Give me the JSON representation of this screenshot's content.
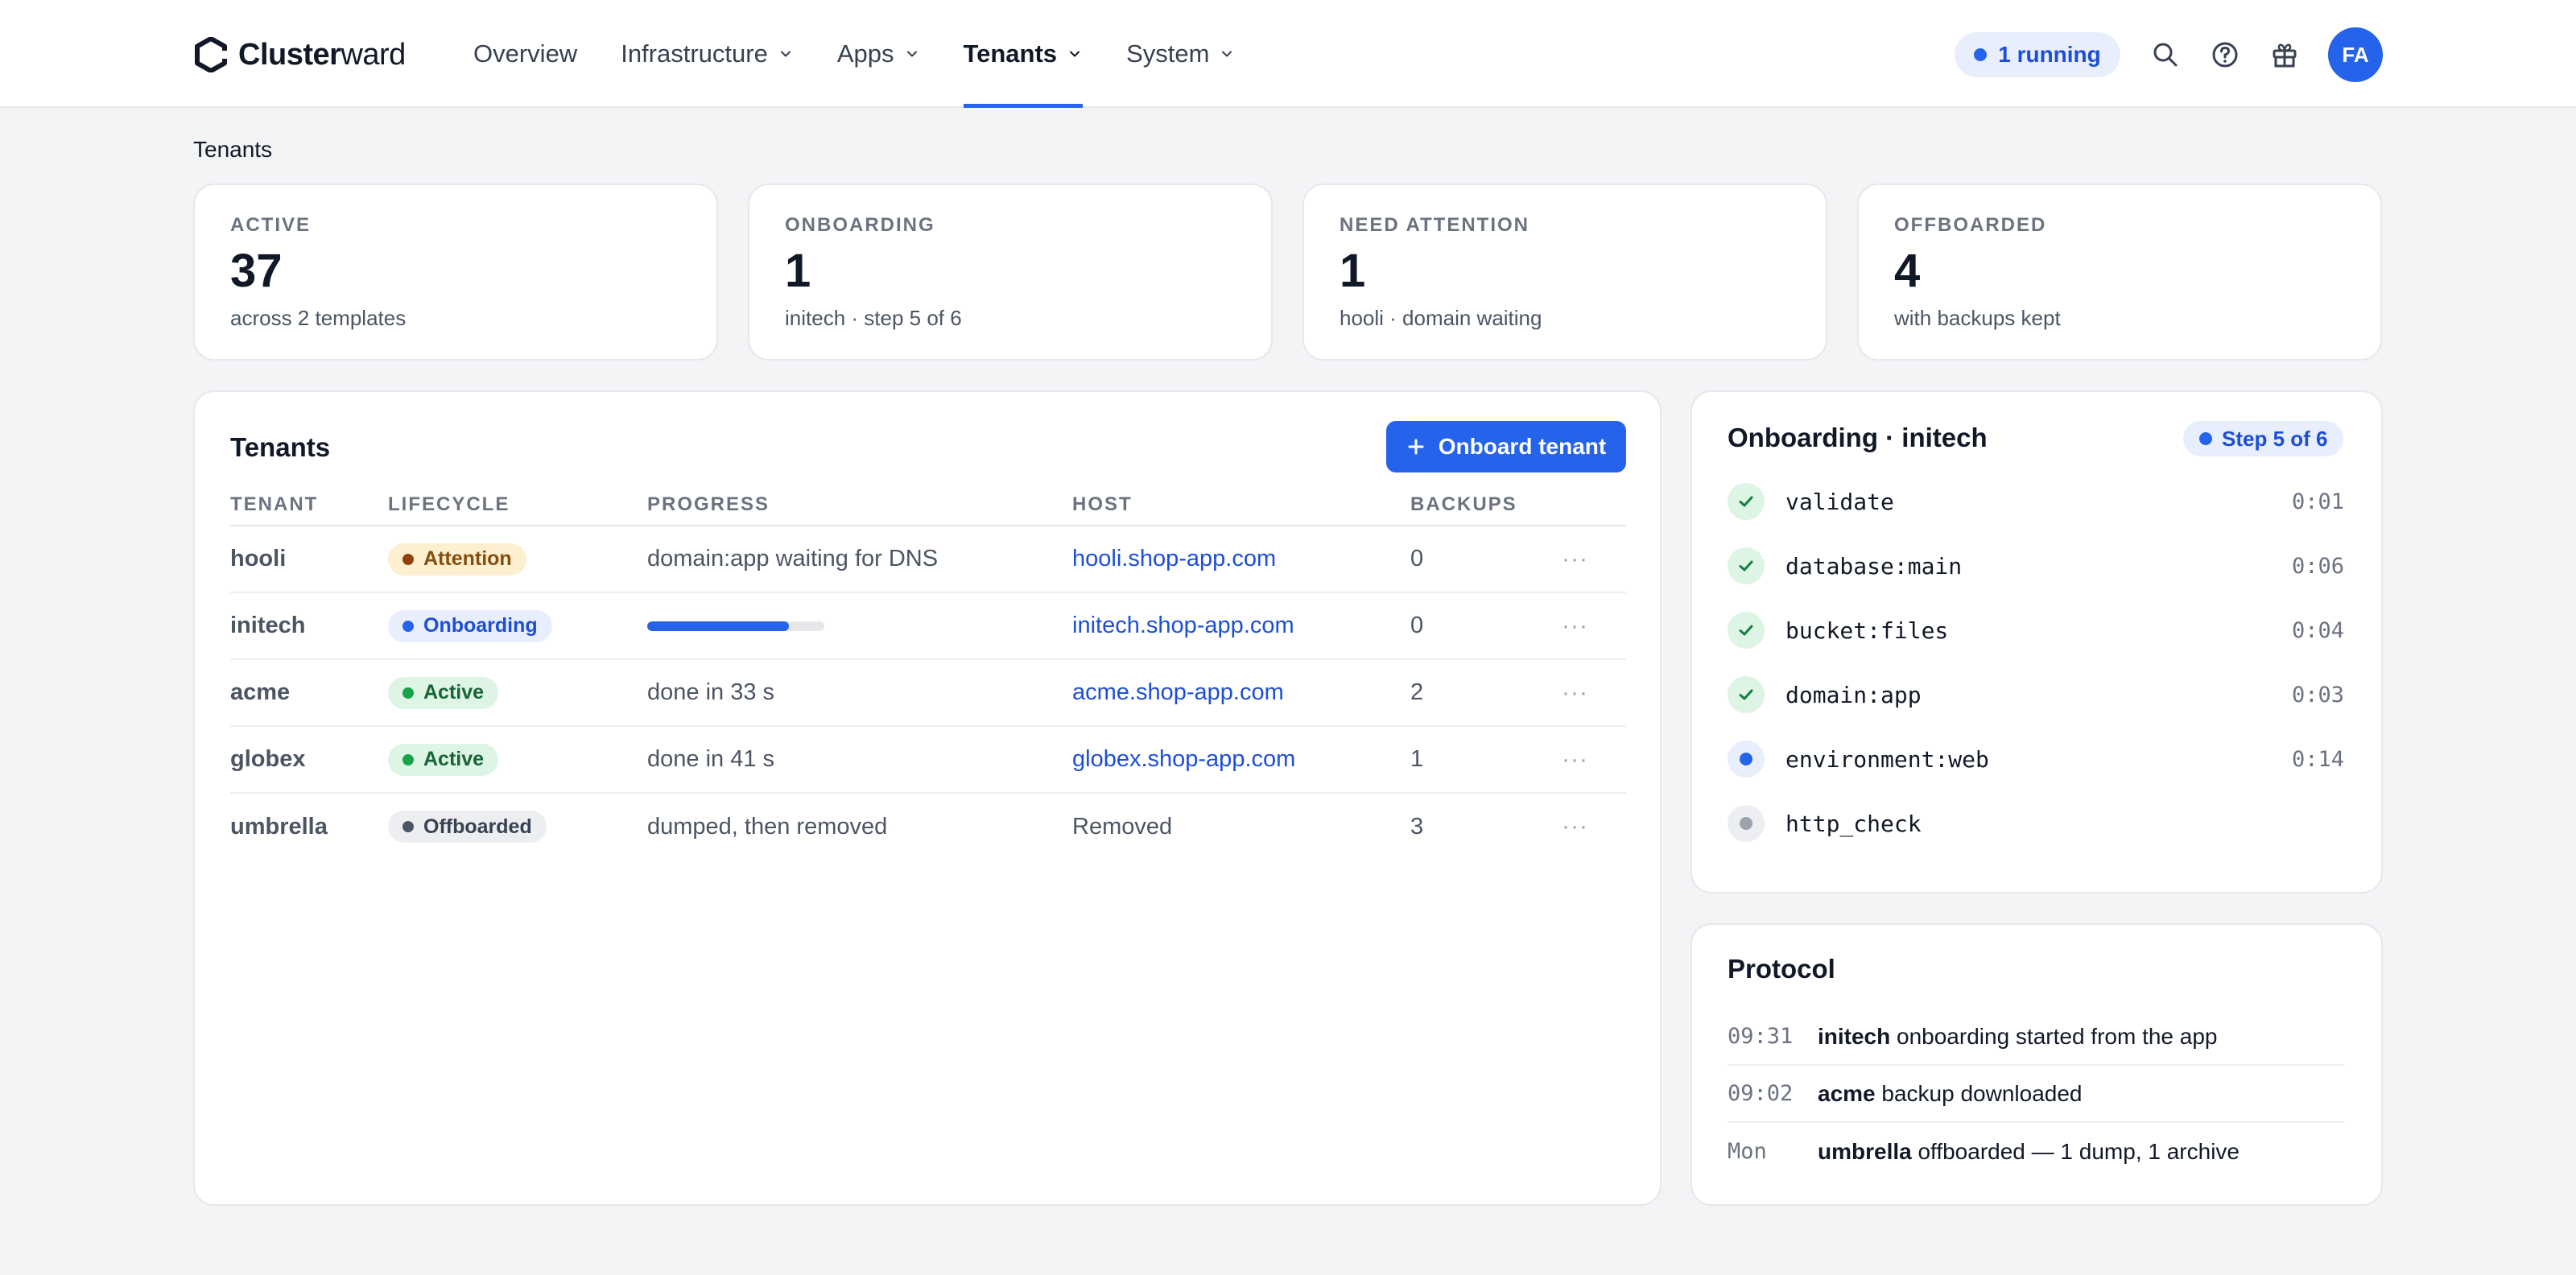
{
  "app": {
    "brand_bold": "Cluster",
    "brand_light": "ward",
    "nav": [
      {
        "label": "Overview",
        "dropdown": false
      },
      {
        "label": "Infrastructure",
        "dropdown": true
      },
      {
        "label": "Apps",
        "dropdown": true
      },
      {
        "label": "Tenants",
        "dropdown": true,
        "active": true
      },
      {
        "label": "System",
        "dropdown": true
      }
    ],
    "running_label": "1 running",
    "avatar_initials": "FA",
    "accent_color": "#2563eb"
  },
  "breadcrumb": "Tenants",
  "stats": [
    {
      "label": "ACTIVE",
      "value": "37",
      "sub": "across 2 templates"
    },
    {
      "label": "ONBOARDING",
      "value": "1",
      "sub": "initech · step 5 of 6"
    },
    {
      "label": "NEED ATTENTION",
      "value": "1",
      "sub": "hooli · domain waiting"
    },
    {
      "label": "OFFBOARDED",
      "value": "4",
      "sub": "with backups kept"
    }
  ],
  "tenants_panel": {
    "title": "Tenants",
    "onboard_button": "Onboard tenant",
    "columns": [
      "TENANT",
      "LIFECYCLE",
      "PROGRESS",
      "HOST",
      "BACKUPS"
    ],
    "rows": [
      {
        "name": "hooli",
        "lifecycle": "Attention",
        "lifecycle_kind": "attention",
        "progress_text": "domain:app waiting for DNS",
        "host": "hooli.shop-app.com",
        "host_is_link": true,
        "backups": "0"
      },
      {
        "name": "initech",
        "lifecycle": "Onboarding",
        "lifecycle_kind": "onboarding",
        "progress_fraction": 0.8,
        "host": "initech.shop-app.com",
        "host_is_link": true,
        "backups": "0"
      },
      {
        "name": "acme",
        "lifecycle": "Active",
        "lifecycle_kind": "active",
        "progress_text": "done in 33 s",
        "host": "acme.shop-app.com",
        "host_is_link": true,
        "backups": "2"
      },
      {
        "name": "globex",
        "lifecycle": "Active",
        "lifecycle_kind": "active",
        "progress_text": "done in 41 s",
        "host": "globex.shop-app.com",
        "host_is_link": true,
        "backups": "1"
      },
      {
        "name": "umbrella",
        "lifecycle": "Offboarded",
        "lifecycle_kind": "offboarded",
        "progress_text": "dumped, then removed",
        "host": "Removed",
        "host_is_link": false,
        "backups": "3"
      }
    ],
    "row_menu_label": "···"
  },
  "onboarding_panel": {
    "title": "Onboarding · initech",
    "step_badge": "Step 5 of 6",
    "steps": [
      {
        "name": "validate",
        "state": "done",
        "time": "0:01"
      },
      {
        "name": "database:main",
        "state": "done",
        "time": "0:06"
      },
      {
        "name": "bucket:files",
        "state": "done",
        "time": "0:04"
      },
      {
        "name": "domain:app",
        "state": "done",
        "time": "0:03"
      },
      {
        "name": "environment:web",
        "state": "running",
        "time": "0:14"
      },
      {
        "name": "http_check",
        "state": "pending",
        "time": ""
      }
    ]
  },
  "protocol_panel": {
    "title": "Protocol",
    "entries": [
      {
        "time": "09:31",
        "subject": "initech",
        "text": " onboarding started from the app"
      },
      {
        "time": "09:02",
        "subject": "acme",
        "text": " backup downloaded"
      },
      {
        "time": "Mon",
        "subject": "umbrella",
        "text": " offboarded — 1 dump, 1 archive"
      }
    ]
  }
}
